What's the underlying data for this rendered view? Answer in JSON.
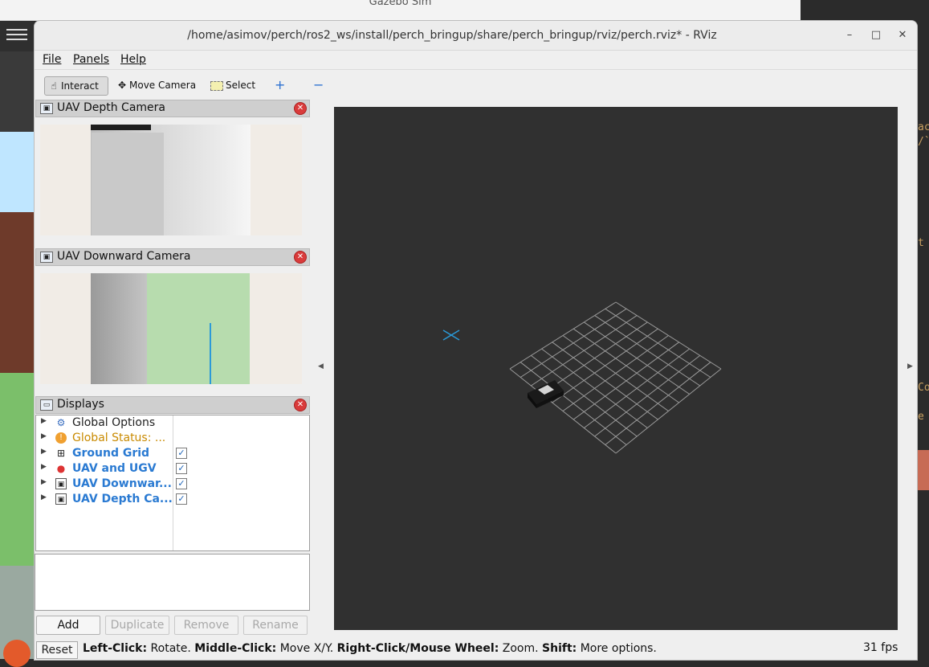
{
  "background_window": {
    "title": "Gazebo Sim"
  },
  "window": {
    "title": "/home/asimov/perch/ros2_ws/install/perch_bringup/share/perch_bringup/rviz/perch.rviz* - RViz",
    "controls": {
      "minimize": "–",
      "maximize": "□",
      "close": "✕"
    }
  },
  "menu": {
    "file": "File",
    "panels": "Panels",
    "help": "Help"
  },
  "toolbar": {
    "interact": "Interact",
    "move_camera": "Move Camera",
    "select": "Select",
    "add_tool": "+",
    "remove_tool": "−"
  },
  "panels": {
    "depth_camera": {
      "title": "UAV Depth Camera"
    },
    "downward_camera": {
      "title": "UAV Downward Camera"
    },
    "displays": {
      "title": "Displays",
      "items": [
        {
          "label": "Global Options",
          "icon": "gear-icon",
          "checked": null
        },
        {
          "label": "Global Status: ...",
          "icon": "warning-icon",
          "checked": null
        },
        {
          "label": "Ground Grid",
          "icon": "grid-icon",
          "checked": true
        },
        {
          "label": "UAV and UGV",
          "icon": "robot-model-icon",
          "checked": true
        },
        {
          "label": "UAV Downwar...",
          "icon": "image-icon",
          "checked": true
        },
        {
          "label": "UAV Depth Ca...",
          "icon": "image-icon",
          "checked": true
        }
      ],
      "buttons": {
        "add": "Add",
        "duplicate": "Duplicate",
        "remove": "Remove",
        "rename": "Rename"
      }
    }
  },
  "status": {
    "reset": "Reset",
    "help": [
      {
        "b": "Left-Click:",
        "t": " Rotate. "
      },
      {
        "b": "Middle-Click:",
        "t": " Move X/Y. "
      },
      {
        "b": "Right-Click/Mouse Wheel:",
        "t": " Zoom. "
      },
      {
        "b": "Shift:",
        "t": " More options."
      }
    ],
    "fps": "31 fps"
  },
  "colors": {
    "viewport_bg": "#303030",
    "accent_blue": "#2a7ad2",
    "warning": "#c98a00"
  }
}
